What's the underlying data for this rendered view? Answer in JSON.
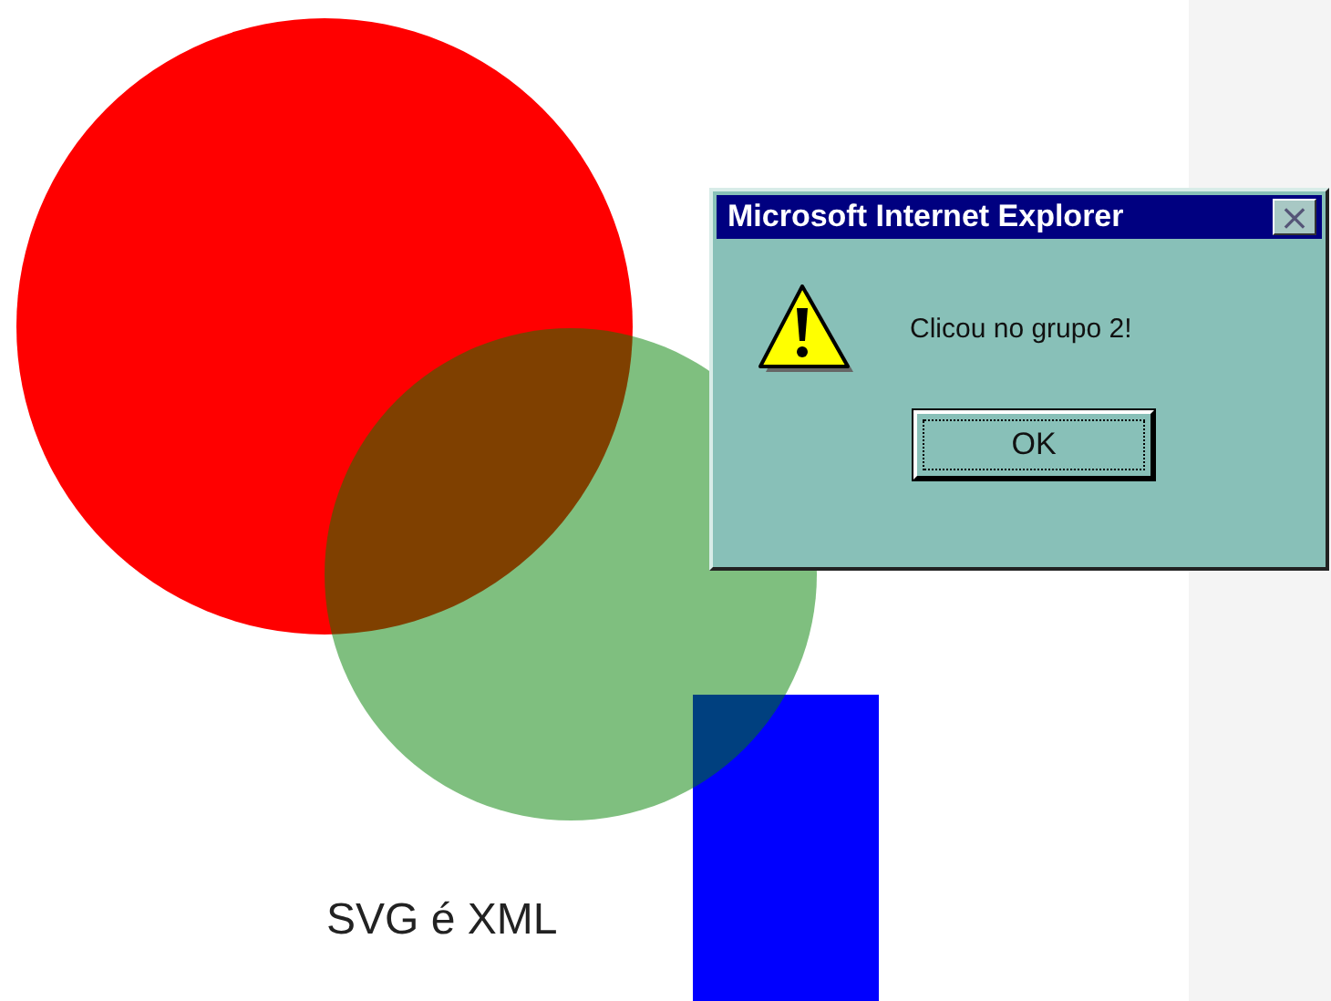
{
  "canvas": {
    "caption": "SVG é XML"
  },
  "dialog": {
    "title": "Microsoft Internet Explorer",
    "close": "×",
    "message": "Clicou no grupo 2!",
    "buttons": [
      "OK"
    ]
  }
}
